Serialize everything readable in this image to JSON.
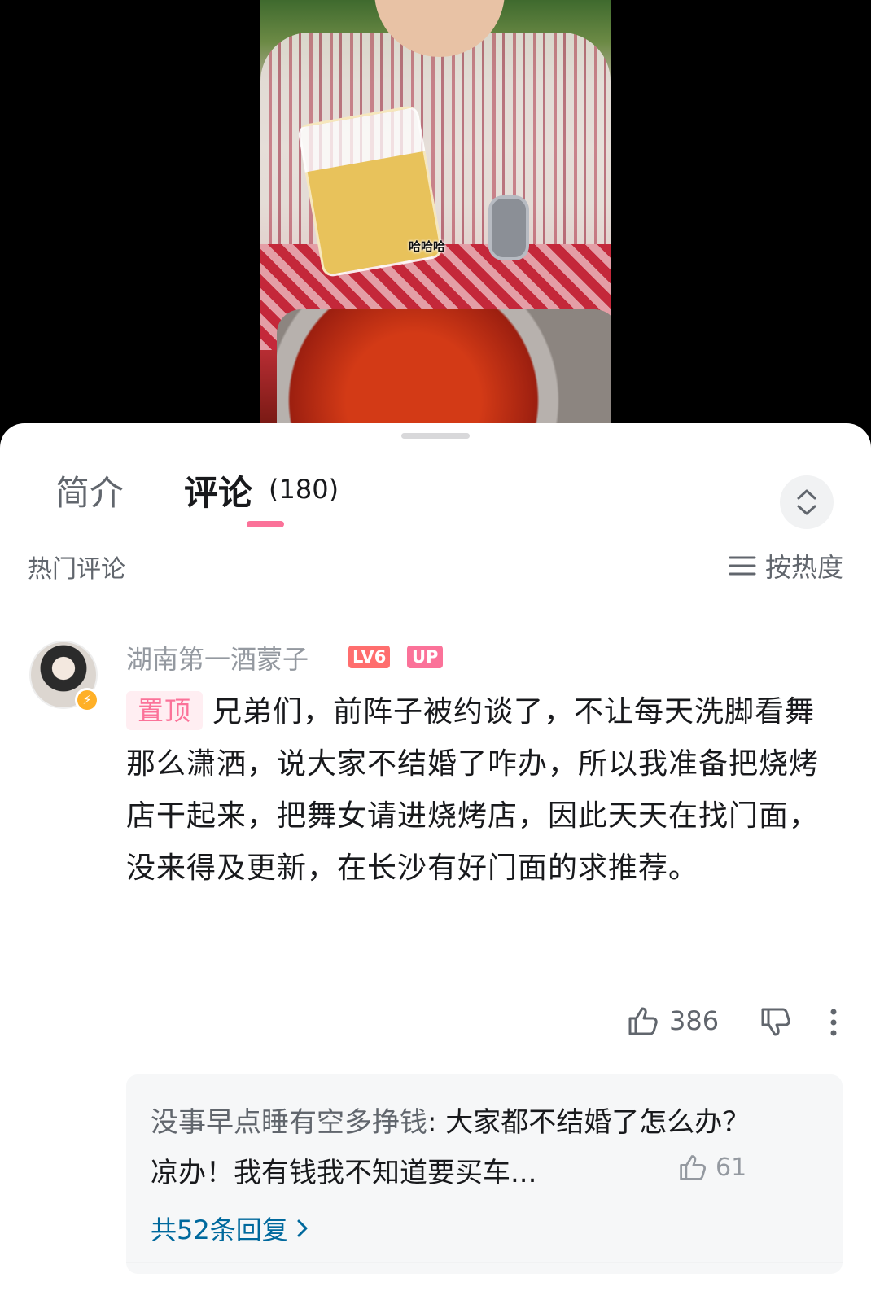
{
  "video": {
    "subtitle": "哈哈哈"
  },
  "tabs": {
    "intro_label": "简介",
    "comments_label": "评论",
    "comments_count": "(180)"
  },
  "section": {
    "hot_label": "热门评论",
    "sort_label": "按热度"
  },
  "comment": {
    "username": "湖南第一酒蒙子",
    "level_badge": "LV6",
    "up_badge": "UP",
    "pin_label": "置顶",
    "text": "兄弟们，前阵子被约谈了，不让每天洗脚看舞那么潇洒，说大家不结婚了咋办，所以我准备把烧烤店干起来，把舞女请进烧烤店，因此天天在找门面，没来得及更新，在长沙有好门面的求推荐。",
    "like_count": "386"
  },
  "reply": {
    "author": "没事早点睡有空多挣钱",
    "text": ": 大家都不结婚了怎么办？凉办！我有钱我不知道要买车...",
    "like_count": "61",
    "more_label": "共52条回复"
  },
  "colors": {
    "accent": "#fb7299",
    "link": "#00699d",
    "level": "#ff6e6e",
    "muted": "#9499a0"
  },
  "icons": [
    "expand-collapse-icon",
    "sort-lines-icon",
    "thumb-up-icon",
    "thumb-down-icon",
    "more-vertical-icon",
    "chevron-right-icon"
  ]
}
